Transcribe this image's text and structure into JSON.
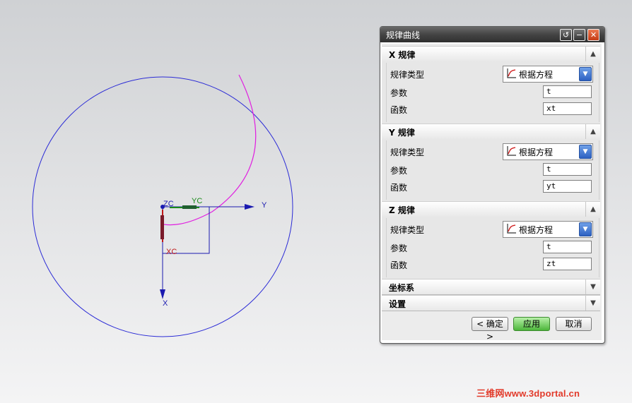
{
  "viewport": {
    "axis_labels": {
      "zc": "ZC",
      "yc": "YC",
      "xc": "XC",
      "y": "Y",
      "x": "X"
    },
    "colors": {
      "circle": "#2b2bd6",
      "curve": "#e020e0",
      "axes": "#1a1ab0",
      "yc": "#1a8a1a",
      "xc": "#c01818"
    }
  },
  "dialog": {
    "title": "规律曲线",
    "groups": [
      {
        "title": "X 规律",
        "law_type_label": "规律类型",
        "law_type_value": "根据方程",
        "param_label": "参数",
        "param_value": "t",
        "func_label": "函数",
        "func_value": "xt"
      },
      {
        "title": "Y 规律",
        "law_type_label": "规律类型",
        "law_type_value": "根据方程",
        "param_label": "参数",
        "param_value": "t",
        "func_label": "函数",
        "func_value": "yt"
      },
      {
        "title": "Z 规律",
        "law_type_label": "规律类型",
        "law_type_value": "根据方程",
        "param_label": "参数",
        "param_value": "t",
        "func_label": "函数",
        "func_value": "zt"
      }
    ],
    "collapsed": [
      {
        "title": "坐标系"
      },
      {
        "title": "设置"
      }
    ],
    "buttons": {
      "ok": "< 确定 >",
      "apply": "应用",
      "cancel": "取消"
    }
  },
  "watermark": "三维网www.3dportal.cn"
}
